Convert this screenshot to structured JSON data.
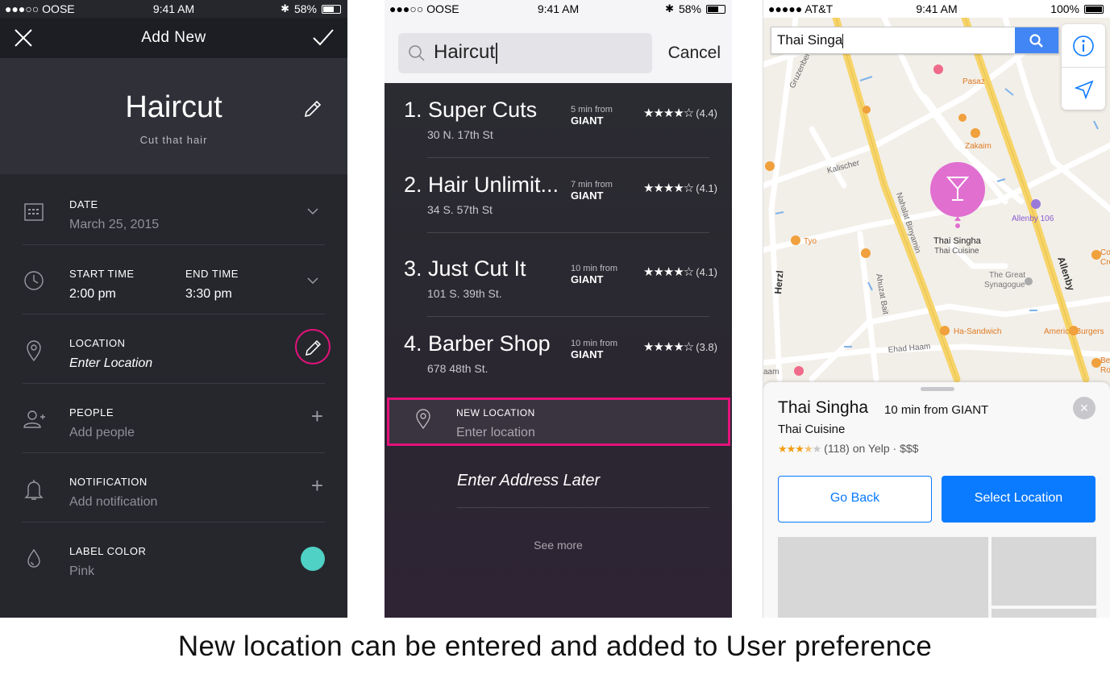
{
  "screen1": {
    "status": {
      "carrier": "●●●○○ OOSE",
      "time": "9:41 AM",
      "battery": "58%",
      "battery_level": 0.58
    },
    "nav": {
      "title": "Add New"
    },
    "event": {
      "title": "Haircut",
      "subtitle": "Cut that hair"
    },
    "date": {
      "label": "DATE",
      "value": "March 25, 2015"
    },
    "time": {
      "start_label": "START TIME",
      "start_value": "2:00 pm",
      "end_label": "END TIME",
      "end_value": "3:30 pm"
    },
    "location": {
      "label": "LOCATION",
      "value": "Enter Location"
    },
    "people": {
      "label": "PEOPLE",
      "placeholder": "Add people"
    },
    "notification": {
      "label": "NOTIFICATION",
      "placeholder": "Add notification"
    },
    "label_color": {
      "label": "LABEL COLOR",
      "value": "Pink",
      "swatch": "#4fd1c5"
    },
    "accent": "#e4127b"
  },
  "screen2": {
    "status": {
      "carrier": "●●●○○ OOSE",
      "time": "9:41 AM",
      "battery": "58%",
      "battery_level": 0.58
    },
    "search": {
      "query": "Haircut",
      "cancel": "Cancel"
    },
    "results": [
      {
        "name": "1. Super Cuts",
        "address": "30 N. 17th St",
        "distance": "5 min from",
        "from": "GIANT",
        "stars": "★★★★☆",
        "rating": "(4.4)"
      },
      {
        "name": "2. Hair Unlimit...",
        "address": "34 S. 57th St",
        "distance": "7 min from",
        "from": "GIANT",
        "stars": "★★★★☆",
        "rating": "(4.1)"
      },
      {
        "name": "3. Just Cut It",
        "address": "101 S. 39th St.",
        "distance": "10 min from",
        "from": "GIANT",
        "stars": "★★★★☆",
        "rating": "(4.1)"
      },
      {
        "name": "4. Barber Shop",
        "address": "678 48th St.",
        "distance": "10 min from",
        "from": "GIANT",
        "stars": "★★★★☆",
        "rating": "(3.8)"
      }
    ],
    "new_location": {
      "label": "NEW LOCATION",
      "placeholder": "Enter location"
    },
    "enter_later": "Enter Address Later",
    "see_more": "See more"
  },
  "screen3": {
    "status": {
      "carrier": "●●●●● AT&T",
      "time": "9:41 AM",
      "battery": "100%",
      "battery_level": 1.0
    },
    "search": {
      "query": "Thai Singa"
    },
    "map_labels": {
      "pin_name": "Thai Singha",
      "pin_type": "Thai Cuisine",
      "pasaz": "Pasaz",
      "zakaim": "Zakaim",
      "kalischer": "Kalischer",
      "gruzenberg": "Gruzenberg",
      "nahalat": "Nahalat Binyamin",
      "allenby106": "Allenby 106",
      "allenby": "Allenby",
      "tyo": "Tyo",
      "ahuzat": "Ahuzat Bait",
      "great_synagogue_1": "The Great",
      "great_synagogue_2": "Synagogue",
      "herzl": "Herzl",
      "ha_sandwich": "Ha-Sandwich",
      "america_burgers": "America Burgers",
      "ehad_haam": "Ehad Haam",
      "cook_1": "Cook",
      "cook_2": "Crea",
      "bene_1": "Bene",
      "bene_2": "Roth",
      "haam": "aam"
    },
    "place": {
      "name": "Thai Singha",
      "distance": "10 min from GIANT",
      "type": "Thai Cuisine",
      "rating_count": "(118) on Yelp · $$$",
      "rating": 3.5
    },
    "buttons": {
      "back": "Go Back",
      "select": "Select Location"
    },
    "colors": {
      "accent": "#0a7aff",
      "pin": "#e06fd0"
    }
  },
  "caption": "New location can be entered and added to User preference"
}
